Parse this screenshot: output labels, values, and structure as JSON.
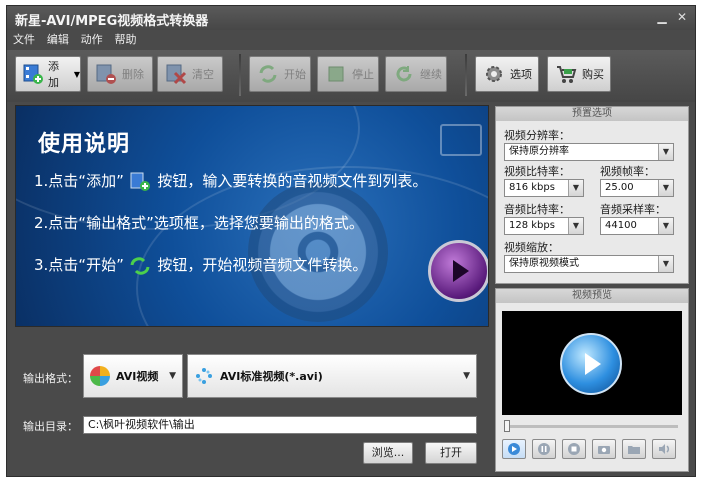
{
  "window": {
    "title": "新星-AVI/MPEG视频格式转换器"
  },
  "menu": [
    "文件",
    "编辑",
    "动作",
    "帮助"
  ],
  "toolbar": {
    "add": "添加",
    "delete": "删除",
    "clear": "清空",
    "start": "开始",
    "stop": "停止",
    "resume": "继续",
    "options": "选项",
    "buy": "购买"
  },
  "banner": {
    "heading": "使用说明",
    "step1_a": "1.点击“添加”",
    "step1_b": "按钮，输入要转换的音视频文件到列表。",
    "step2": "2.点击“输出格式”选项框，选择您要输出的格式。",
    "step3_a": "3.点击“开始”",
    "step3_b": "按钮，开始视频音频文件转换。"
  },
  "output": {
    "format_label": "输出格式：",
    "format_category": "AVI视频",
    "format_detail": "AVI标准视频(*.avi)",
    "dir_label": "输出目录：",
    "dir_value": "C:\\枫叶视频软件\\输出",
    "browse": "浏览...",
    "open": "打开"
  },
  "preset": {
    "title": "预置选项",
    "resolution_label": "视频分辨率：",
    "resolution_value": "保持原分辨率",
    "vbitrate_label": "视频比特率：",
    "vbitrate_value": "816 kbps",
    "framerate_label": "视频帧率：",
    "framerate_value": "25.00",
    "abitrate_label": "音频比特率：",
    "abitrate_value": "128 kbps",
    "samplerate_label": "音频采样率：",
    "samplerate_value": "44100",
    "zoom_label": "视频缩放：",
    "zoom_value": "保持原视频模式"
  },
  "preview": {
    "title": "视频预览"
  },
  "colors": {
    "window_bg": "#4a4a4a",
    "banner_bg": "#0f4f9a",
    "panel_bg": "#e9e9e9"
  }
}
